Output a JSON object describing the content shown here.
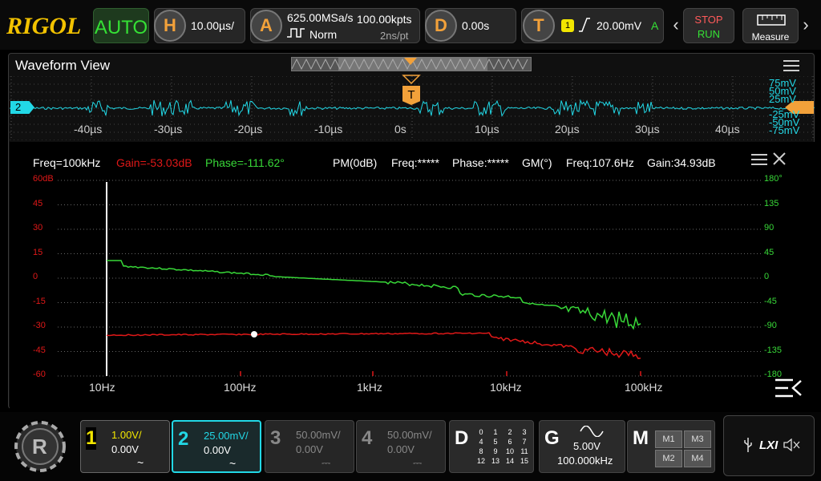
{
  "top": {
    "brand": "RIGOL",
    "mode": "AUTO",
    "horizontal": {
      "key": "H",
      "timebase": "10.00µs/"
    },
    "acquire": {
      "key": "A",
      "sample_rate": "625.00MSa/s",
      "memory": "100.00kpts",
      "mode": "Norm",
      "resolution": "2ns/pt"
    },
    "delay": {
      "key": "D",
      "value": "0.00s"
    },
    "trigger": {
      "key": "T",
      "source": "1",
      "level": "20.00mV",
      "mode": "A"
    },
    "stop": "STOP",
    "run": "RUN",
    "measure": "Measure"
  },
  "waveform": {
    "title": "Waveform View",
    "ch_marker": "2",
    "trigger_marker": "T",
    "time_labels": [
      "-40µs",
      "-30µs",
      "-20µs",
      "-10µs",
      "0s",
      "10µs",
      "20µs",
      "30µs",
      "40µs"
    ],
    "volt_labels": [
      "75mV",
      "50mV",
      "25mV",
      "-25mV",
      "-50mV",
      "-75mV"
    ]
  },
  "bode": {
    "freq": "Freq=100kHz",
    "gain": "Gain=-53.03dB",
    "phase": "Phase=-111.62°",
    "pm": "PM(0dB)",
    "pm_freq": "Freq:*****",
    "pm_phase": "Phase:*****",
    "gm": "GM(°)",
    "gm_freq": "Freq:107.6Hz",
    "gm_gain": "Gain:34.93dB",
    "y_left": [
      "60dB",
      "45",
      "30",
      "15",
      "0",
      "-15",
      "-30",
      "-45",
      "-60"
    ],
    "y_right": [
      "180°",
      "135",
      "90",
      "45",
      "0",
      "-45",
      "-90",
      "-135",
      "-180"
    ],
    "x_labels": [
      "10Hz",
      "100Hz",
      "1kHz",
      "10kHz",
      "100kHz"
    ],
    "colors": {
      "gain": "#e01818",
      "phase": "#38d838",
      "grid": "#666666"
    }
  },
  "channels": [
    {
      "num": "1",
      "scale": "1.00V/",
      "offset": "0.00V",
      "coupling": "~",
      "color": "#f2e600",
      "active": true
    },
    {
      "num": "2",
      "scale": "25.00mV/",
      "offset": "0.00V",
      "coupling": "~",
      "color": "#22d8e6",
      "active": true
    },
    {
      "num": "3",
      "scale": "50.00mV/",
      "offset": "0.00V",
      "coupling": "⎓",
      "color": "#888888",
      "active": false
    },
    {
      "num": "4",
      "scale": "50.00mV/",
      "offset": "0.00V",
      "coupling": "⎓",
      "color": "#888888",
      "active": false
    }
  ],
  "digital": {
    "key": "D",
    "rows": [
      [
        "0",
        "1",
        "2",
        "3"
      ],
      [
        "4",
        "5",
        "6",
        "7"
      ],
      [
        "8",
        "9",
        "10",
        "11"
      ],
      [
        "12",
        "13",
        "14",
        "15"
      ]
    ]
  },
  "generator": {
    "key": "G",
    "amplitude": "5.00V",
    "frequency": "100.000kHz"
  },
  "math": {
    "key": "M",
    "buttons": [
      "M1",
      "M3",
      "M2",
      "M4"
    ]
  },
  "status": {
    "lxi": "LXI"
  }
}
